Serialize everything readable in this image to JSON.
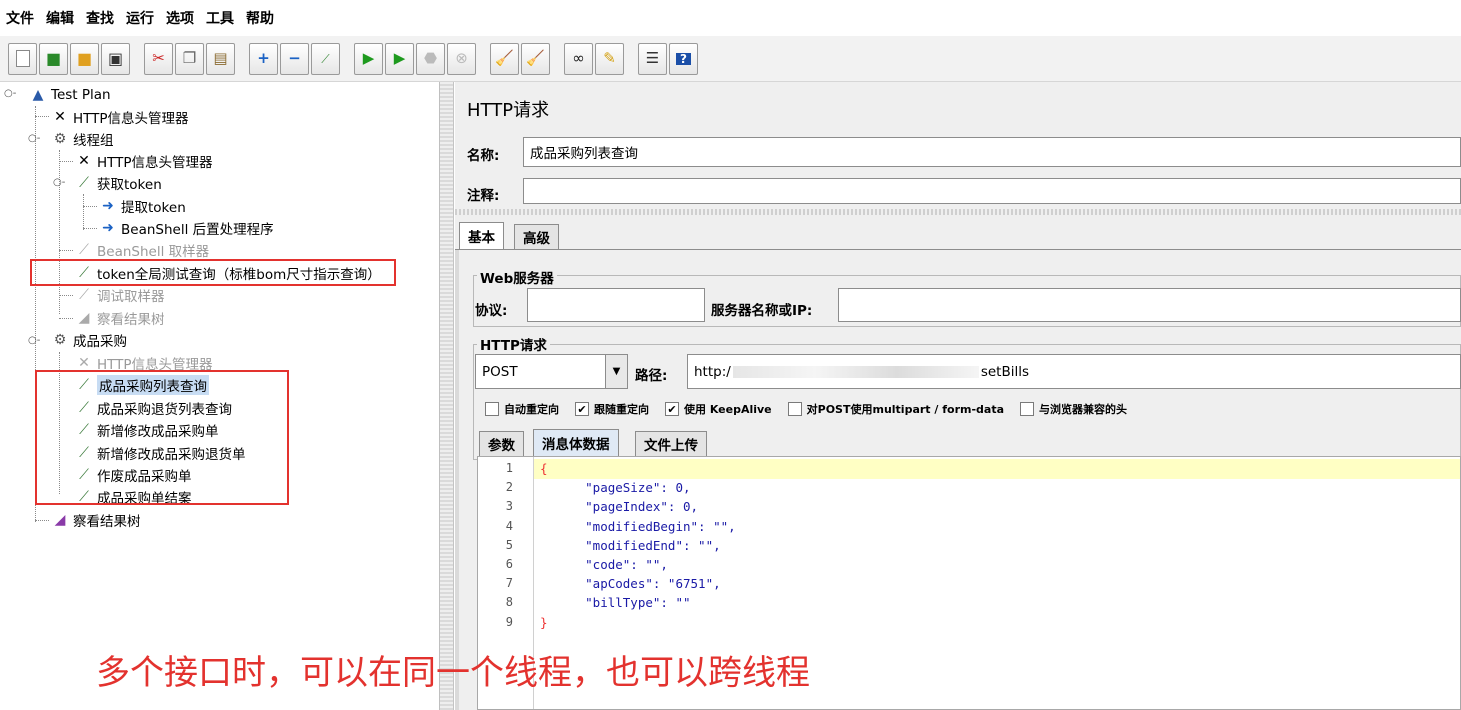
{
  "menu": [
    "文件",
    "编辑",
    "查找",
    "运行",
    "选项",
    "工具",
    "帮助"
  ],
  "toolbar_icons": [
    "new-icon",
    "template-icon",
    "open-icon",
    "save-icon",
    "cut-icon",
    "copy-icon",
    "paste-icon",
    "expand-icon",
    "collapse-icon",
    "toggle-icon",
    "start-icon",
    "start-no-pause-icon",
    "stop-icon",
    "shutdown-icon",
    "clear-icon",
    "clear-all-icon",
    "search-icon",
    "reset-search-icon",
    "function-helper-icon",
    "help-icon"
  ],
  "tree": {
    "root": "Test Plan",
    "header_manager": "HTTP信息头管理器",
    "thread_group_1": "线程组",
    "tg1_header_manager": "HTTP信息头管理器",
    "get_token": "获取token",
    "extract_token": "提取token",
    "beanshell_post": "BeanShell 后置处理程序",
    "beanshell_sampler": "BeanShell 取样器",
    "token_query": "token全局测试查询（标椎bom尺寸指示查询）",
    "debug_sampler": "调试取样器",
    "view_results_1": "察看结果树",
    "thread_group_2": "成品采购",
    "tg2_header_manager": "HTTP信息头管理器",
    "item_list_query": "成品采购列表查询",
    "item_return_query": "成品采购退货列表查询",
    "item_add_edit": "新增修改成品采购单",
    "item_add_edit_return": "新增修改成品采购退货单",
    "item_void": "作废成品采购单",
    "item_close": "成品采购单结案",
    "view_results_2": "察看结果树"
  },
  "panel": {
    "title": "HTTP请求",
    "name_label": "名称:",
    "name_value": "成品采购列表查询",
    "comment_label": "注释:",
    "comment_value": "",
    "tab_basic": "基本",
    "tab_advanced": "高级",
    "web_server_group": "Web服务器",
    "protocol_label": "协议:",
    "protocol_value": "",
    "server_label": "服务器名称或IP:",
    "server_value": "",
    "http_request_group": "HTTP请求",
    "method": "POST",
    "path_label": "路径:",
    "path_value": "http:/",
    "path_value_end": "setBills",
    "checkboxes": [
      {
        "label": "自动重定向",
        "checked": false
      },
      {
        "label": "跟随重定向",
        "checked": true
      },
      {
        "label": "使用 KeepAlive",
        "checked": true
      },
      {
        "label": "对POST使用multipart / form-data",
        "checked": false
      },
      {
        "label": "与浏览器兼容的头",
        "checked": false
      }
    ],
    "tab_params": "参数",
    "tab_body": "消息体数据",
    "tab_files": "文件上传"
  },
  "code": {
    "line_numbers": [
      "1",
      "2",
      "3",
      "4",
      "5",
      "6",
      "7",
      "8",
      "9"
    ],
    "lines": [
      "{",
      "      \"pageSize\": 0,",
      "      \"pageIndex\": 0,",
      "      \"modifiedBegin\": \"\",",
      "      \"modifiedEnd\": \"\",",
      "      \"code\": \"\",",
      "      \"apCodes\": \"6751\",",
      "      \"billType\": \"\"",
      "}"
    ]
  },
  "annotation": "多个接口时，可以在同一个线程，也可以跨线程"
}
